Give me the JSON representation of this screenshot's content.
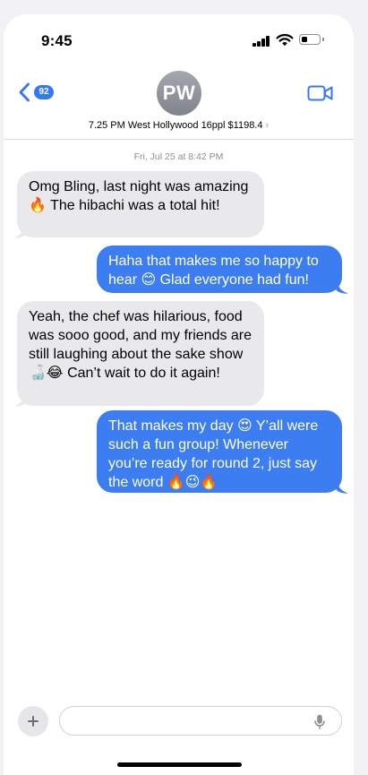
{
  "status_bar": {
    "time": "9:45",
    "signal_icon": "cellular-signal-icon",
    "wifi_icon": "wifi-icon",
    "battery_icon": "battery-icon",
    "battery_level": 0.35
  },
  "header": {
    "back_icon": "chevron-left-icon",
    "unread_count": "92",
    "avatar_initials": "PW",
    "contact_name": "7.25 PM West Hollywood 16ppl $1198.4",
    "contact_chevron": "›",
    "video_icon": "video-camera-icon"
  },
  "thread": {
    "timestamp": "Fri, Jul 25 at 8:42 PM",
    "messages": [
      {
        "direction": "incoming",
        "text": "Omg Bling, last night was amazing 🔥 The hibachi was a total hit!"
      },
      {
        "direction": "outgoing",
        "text": "Haha that makes me so happy to hear 😊 Glad everyone had fun!"
      },
      {
        "direction": "incoming",
        "text": "Yeah, the chef was hilarious, food was sooo good, and my friends are still laughing about the sake show 🍶😂 Can’t wait to do it again!"
      },
      {
        "direction": "outgoing",
        "text": "That makes my day 😍 Y’all were such a fun group! Whenever you’re ready for round 2, just say the word 🔥😉🔥"
      }
    ]
  },
  "composer": {
    "plus_icon": "plus-icon",
    "input_value": "",
    "input_placeholder": "",
    "mic_icon": "microphone-icon"
  },
  "colors": {
    "outgoing_bubble": "#3c7ef2",
    "incoming_bubble": "#e9e9eb",
    "accent": "#3478f6"
  }
}
